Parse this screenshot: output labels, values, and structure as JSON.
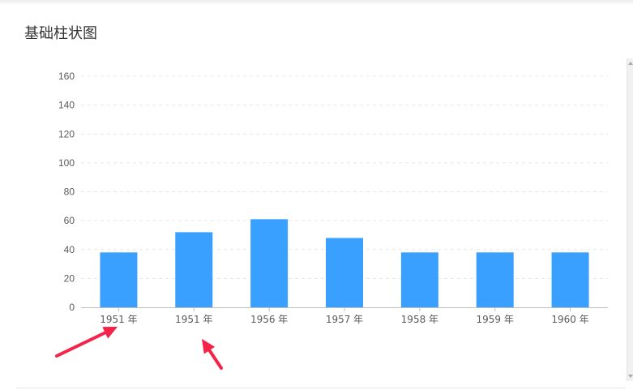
{
  "card": {
    "title": "基础柱状图"
  },
  "chart_data": {
    "type": "bar",
    "categories": [
      "1951 年",
      "1951 年",
      "1956 年",
      "1957 年",
      "1958 年",
      "1959 年",
      "1960 年"
    ],
    "values": [
      38,
      52,
      61,
      48,
      38,
      38,
      38
    ],
    "title": "",
    "xlabel": "",
    "ylabel": "",
    "ylim": [
      0,
      160
    ],
    "yticks": [
      0,
      20,
      40,
      60,
      80,
      100,
      120,
      140,
      160
    ],
    "grid": true,
    "bar_color": "#3aa0ff"
  },
  "annotations": {
    "arrow_color": "#f5234a"
  }
}
